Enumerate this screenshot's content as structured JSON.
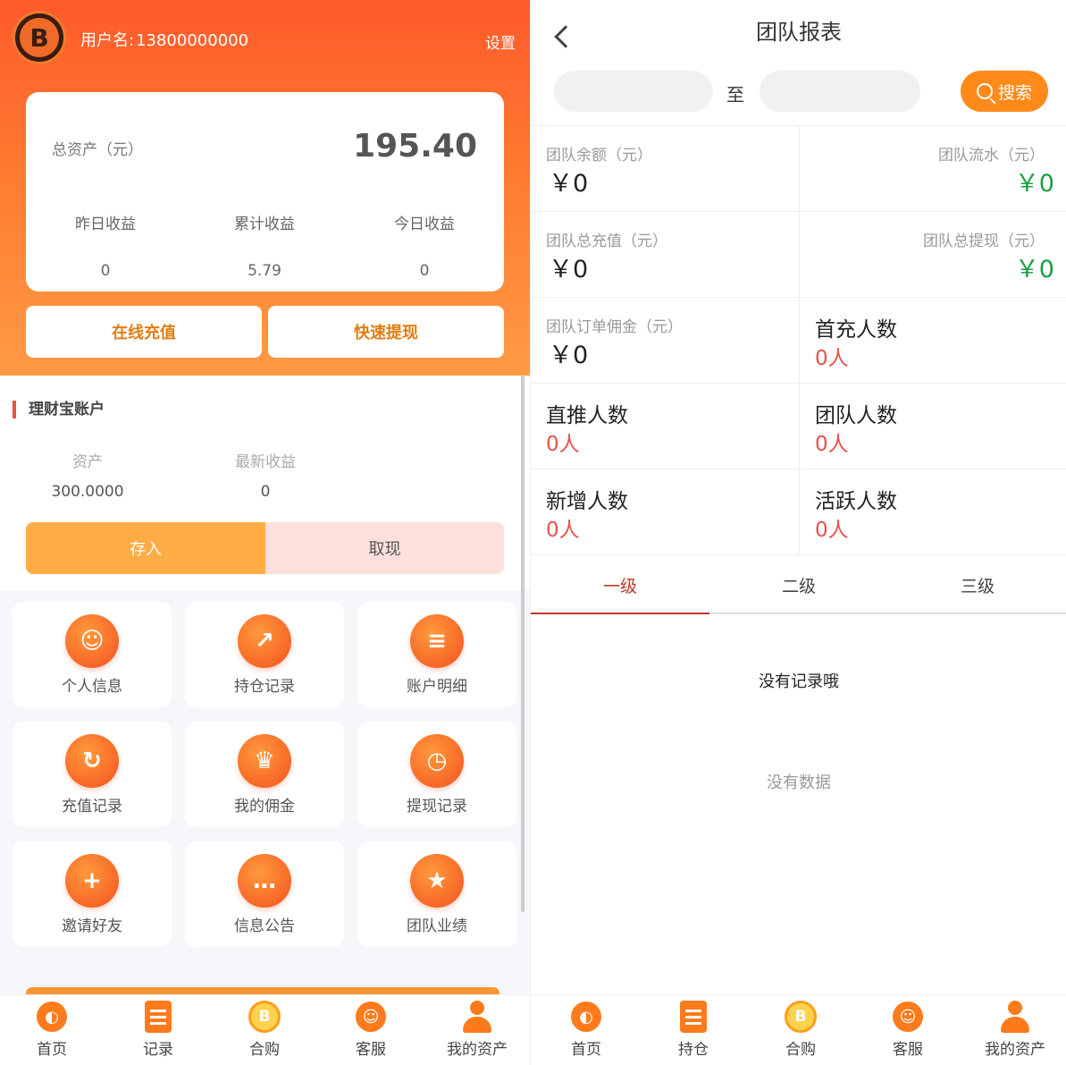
{
  "left": {
    "header": {
      "logo_text": "B",
      "username_label": "用户名:",
      "username_value": "13800000000",
      "settings_label": "设置"
    },
    "asset_card": {
      "total_label": "总资产（元）",
      "total_value": "195.40",
      "stats": [
        {
          "label": "昨日收益",
          "value": "0"
        },
        {
          "label": "累计收益",
          "value": "5.79"
        },
        {
          "label": "今日收益",
          "value": "0"
        }
      ]
    },
    "actions": {
      "recharge": "在线充值",
      "withdraw": "快速提现"
    },
    "wealth": {
      "title": "理财宝账户",
      "asset_label": "资产",
      "asset_value": "300.0000",
      "profit_label": "最新收益",
      "profit_value": "0",
      "deposit": "存入",
      "withdraw": "取现"
    },
    "menu": [
      {
        "label": "个人信息",
        "icon": "smile-icon"
      },
      {
        "label": "持仓记录",
        "icon": "chart-up-icon"
      },
      {
        "label": "账户明细",
        "icon": "list-icon"
      },
      {
        "label": "充值记录",
        "icon": "refresh-icon"
      },
      {
        "label": "我的佣金",
        "icon": "trophy-icon"
      },
      {
        "label": "提现记录",
        "icon": "clock-icon"
      },
      {
        "label": "邀请好友",
        "icon": "plus-icon"
      },
      {
        "label": "信息公告",
        "icon": "chat-icon"
      },
      {
        "label": "团队业绩",
        "icon": "star-icon"
      }
    ],
    "tabbar": [
      {
        "label": "首页",
        "icon": "home-planet-icon"
      },
      {
        "label": "记录",
        "icon": "document-icon"
      },
      {
        "label": "合购",
        "icon": "coin-icon"
      },
      {
        "label": "客服",
        "icon": "service-icon"
      },
      {
        "label": "我的资产",
        "icon": "user-icon"
      }
    ]
  },
  "right": {
    "title": "团队报表",
    "date_separator": "至",
    "search_label": "搜索",
    "stats": [
      {
        "label": "团队余额（元）",
        "value": "￥0"
      },
      {
        "label": "团队流水（元）",
        "value": "￥0"
      },
      {
        "label": "团队总充值（元）",
        "value": "￥0"
      },
      {
        "label": "团队总提现（元）",
        "value": "￥0"
      },
      {
        "label": "团队订单佣金（元）",
        "value": "￥0"
      },
      {
        "label": "首充人数",
        "value": "0人"
      },
      {
        "label": "直推人数",
        "value": "0人"
      },
      {
        "label": "团队人数",
        "value": "0人"
      },
      {
        "label": "新增人数",
        "value": "0人"
      },
      {
        "label": "活跃人数",
        "value": "0人"
      }
    ],
    "level_tabs": [
      "一级",
      "二级",
      "三级"
    ],
    "empty_record": "没有记录哦",
    "empty_data": "没有数据",
    "tabbar": [
      {
        "label": "首页",
        "icon": "home-planet-icon"
      },
      {
        "label": "持仓",
        "icon": "document-icon"
      },
      {
        "label": "合购",
        "icon": "coin-icon"
      },
      {
        "label": "客服",
        "icon": "service-icon"
      },
      {
        "label": "我的资产",
        "icon": "user-icon"
      }
    ]
  },
  "colors": {
    "brand_orange": "#ff7a1a",
    "green_value": "#1aa040",
    "red_value": "#e8524b",
    "active_tab": "#c0392b"
  }
}
